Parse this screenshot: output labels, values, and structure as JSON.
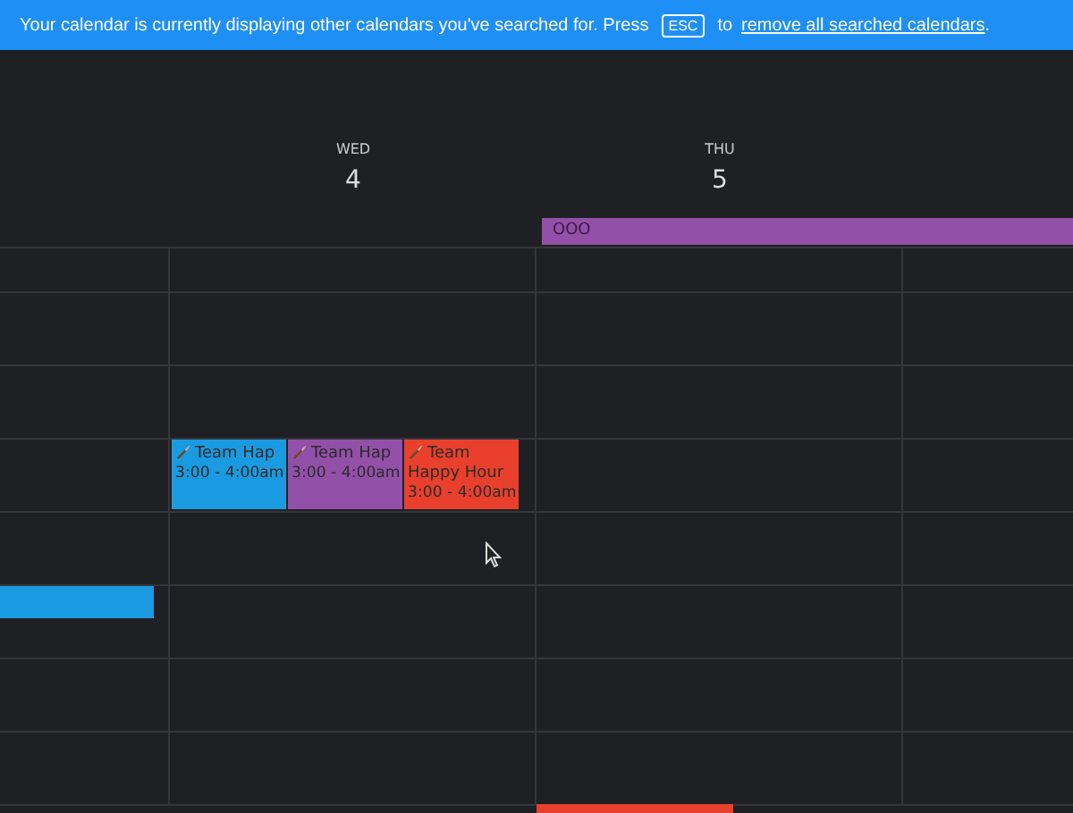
{
  "banner": {
    "message": "Your calendar is currently displaying other calendars you've searched for. Press",
    "key": "ESC",
    "connector": "to",
    "link": "remove all searched calendars",
    "end": "."
  },
  "days": [
    {
      "weekday": "WED",
      "date": "4"
    },
    {
      "weekday": "THU",
      "date": "5"
    }
  ],
  "all_day_events": [
    {
      "title": "OOO",
      "color": "#9350a8"
    }
  ],
  "events": [
    {
      "title": "Team Hap",
      "time": "3:00 - 4:00am",
      "color": "#1a9ae0"
    },
    {
      "title": "Team Hap",
      "time": "3:00 - 4:00am",
      "color": "#9350a8"
    },
    {
      "title": "Team Happy Hour",
      "time": "3:00 - 4:00am",
      "color": "#e8402c"
    }
  ],
  "other_events": [
    {
      "kind": "bar",
      "color": "#1a9ae0"
    },
    {
      "kind": "edge",
      "color": "#e8402c"
    }
  ]
}
